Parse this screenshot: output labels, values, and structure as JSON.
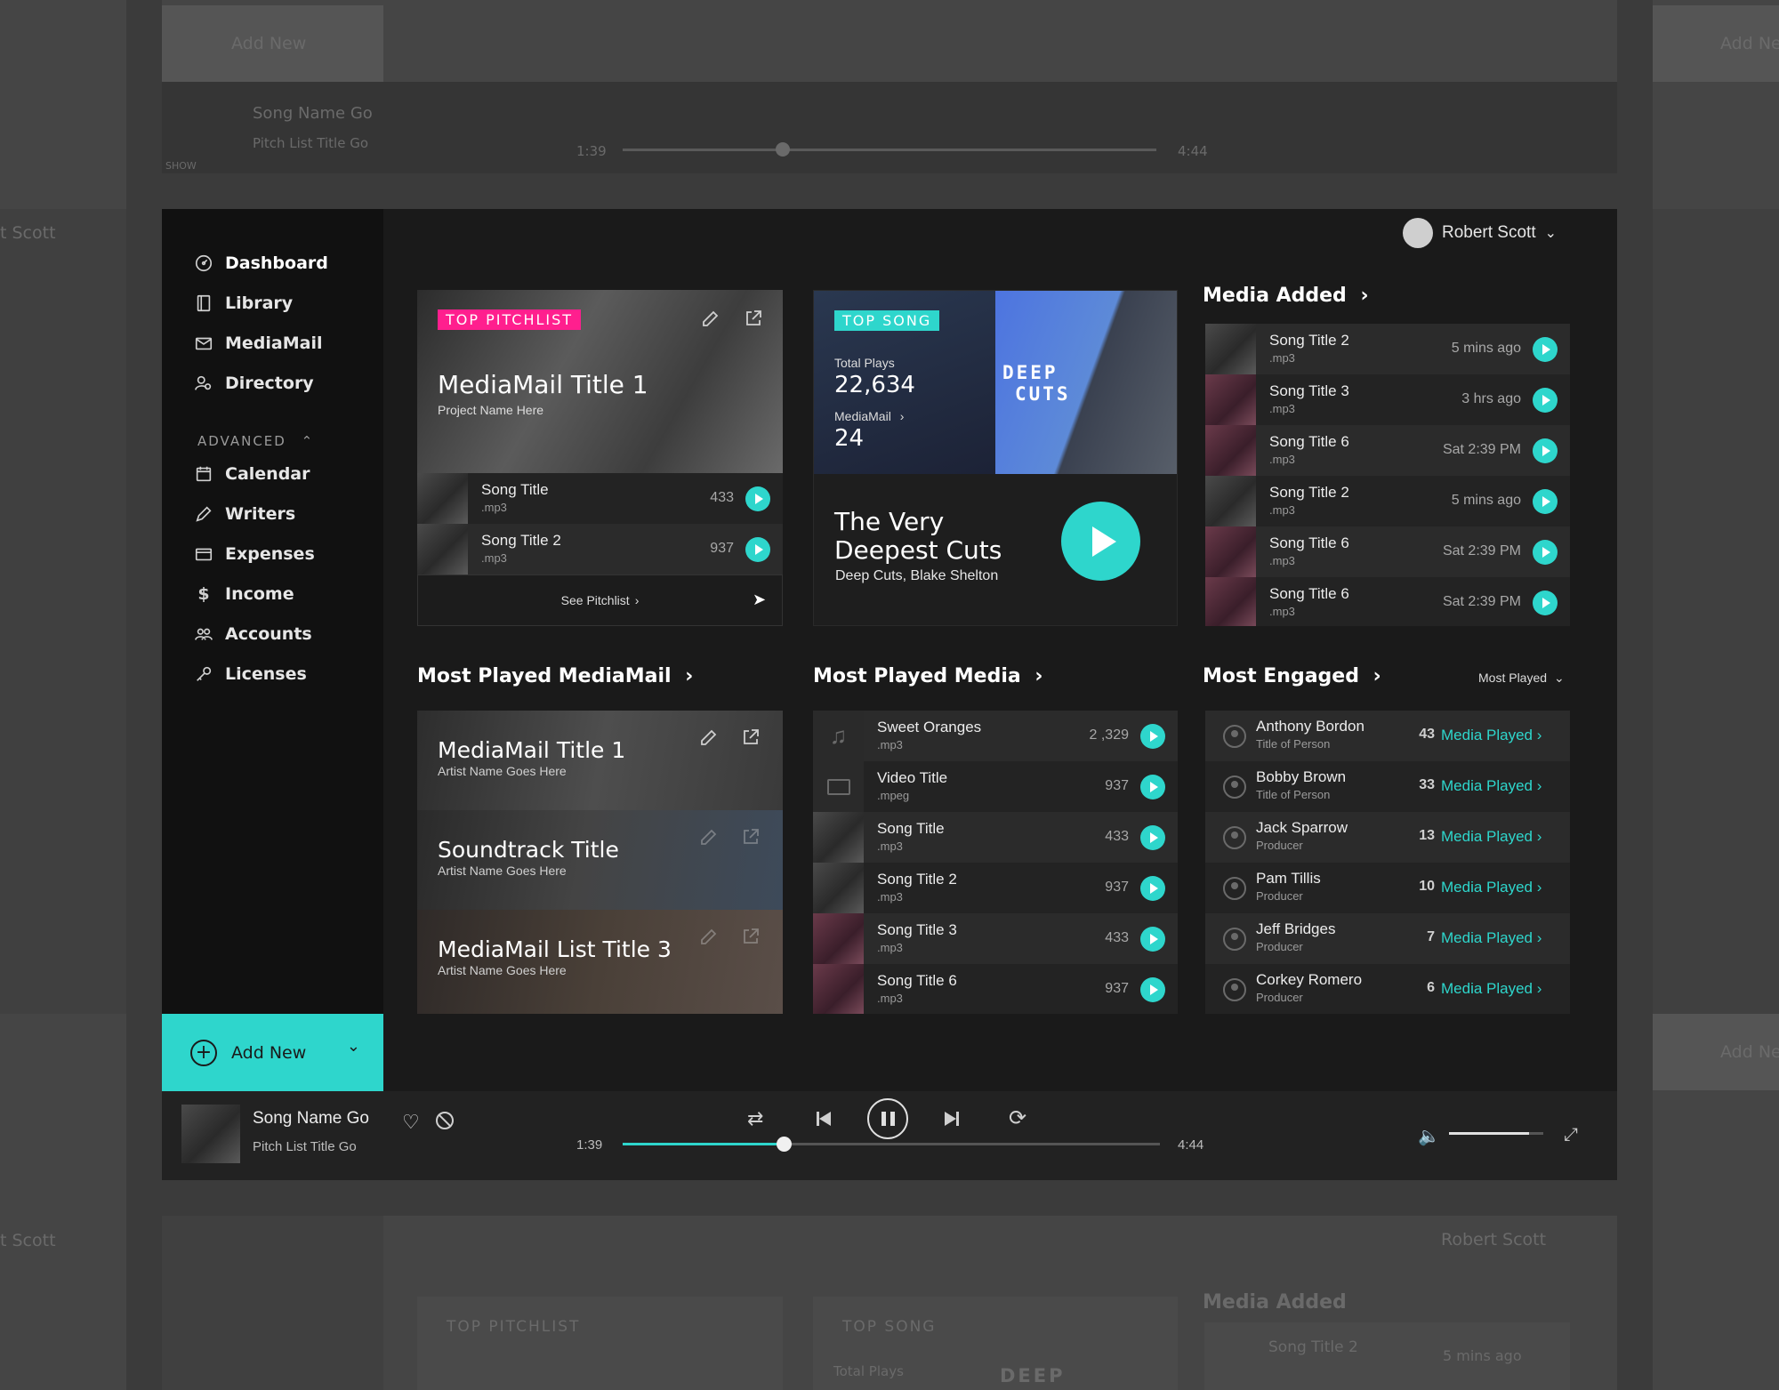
{
  "user": {
    "name": "Robert Scott"
  },
  "sidebar": {
    "items": [
      {
        "label": "Dashboard",
        "icon": "dashboard-icon",
        "active": true
      },
      {
        "label": "Library",
        "icon": "library-icon"
      },
      {
        "label": "MediaMail",
        "icon": "mail-icon"
      },
      {
        "label": "Directory",
        "icon": "directory-icon"
      }
    ],
    "advanced_label": "ADVANCED",
    "advanced_items": [
      {
        "label": "Calendar",
        "icon": "calendar-icon"
      },
      {
        "label": "Writers",
        "icon": "pen-icon"
      },
      {
        "label": "Expenses",
        "icon": "wallet-icon"
      },
      {
        "label": "Income",
        "icon": "dollar-icon"
      },
      {
        "label": "Accounts",
        "icon": "accounts-icon"
      },
      {
        "label": "Licenses",
        "icon": "key-icon"
      }
    ],
    "add_new": "Add New"
  },
  "top_pitchlist": {
    "badge": "TOP PITCHLIST",
    "title": "MediaMail Title 1",
    "subtitle": "Project Name Here",
    "songs": [
      {
        "title": "Song Title",
        "format": ".mp3",
        "count": "433"
      },
      {
        "title": "Song Title 2",
        "format": ".mp3",
        "count": "937"
      }
    ],
    "see_all": "See Pitchlist"
  },
  "top_song": {
    "badge": "TOP SONG",
    "plays_label": "Total Plays",
    "plays_value": "22,634",
    "mediamail_label": "MediaMail",
    "mediamail_value": "24",
    "cover_text_1": "DEEP",
    "cover_text_2": "CUTS",
    "title_line1": "The Very",
    "title_line2": "Deepest Cuts",
    "artist": "Deep Cuts, Blake Shelton"
  },
  "media_added": {
    "title": "Media Added",
    "items": [
      {
        "title": "Song Title 2",
        "format": ".mp3",
        "time": "5 mins ago"
      },
      {
        "title": "Song Title 3",
        "format": ".mp3",
        "time": "3 hrs ago"
      },
      {
        "title": "Song Title 6",
        "format": ".mp3",
        "time": "Sat 2:39 PM"
      },
      {
        "title": "Song Title 2",
        "format": ".mp3",
        "time": "5 mins ago"
      },
      {
        "title": "Song Title 6",
        "format": ".mp3",
        "time": "Sat 2:39 PM"
      },
      {
        "title": "Song Title 6",
        "format": ".mp3",
        "time": "Sat 2:39 PM"
      }
    ]
  },
  "most_played_mediamail": {
    "title": "Most Played MediaMail",
    "items": [
      {
        "title": "MediaMail Title 1",
        "subtitle": "Artist Name Goes Here"
      },
      {
        "title": "Soundtrack Title",
        "subtitle": "Artist Name Goes Here"
      },
      {
        "title": "MediaMail List Title 3",
        "subtitle": "Artist Name Goes Here"
      }
    ]
  },
  "most_played_media": {
    "title": "Most Played Media",
    "items": [
      {
        "title": "Sweet Oranges",
        "format": ".mp3",
        "count": "2 ,329"
      },
      {
        "title": "Video Title",
        "format": ".mpeg",
        "count": "937"
      },
      {
        "title": "Song Title",
        "format": ".mp3",
        "count": "433"
      },
      {
        "title": "Song Title 2",
        "format": ".mp3",
        "count": "937"
      },
      {
        "title": "Song Title 3",
        "format": ".mp3",
        "count": "433"
      },
      {
        "title": "Song Title 6",
        "format": ".mp3",
        "count": "937"
      }
    ]
  },
  "most_engaged": {
    "title": "Most Engaged",
    "filter": "Most Played",
    "link_label": "Media Played",
    "items": [
      {
        "name": "Anthony Bordon",
        "role": "Title of Person",
        "count": "43"
      },
      {
        "name": "Bobby Brown",
        "role": "Title of Person",
        "count": "33"
      },
      {
        "name": "Jack Sparrow",
        "role": "Producer",
        "count": "13"
      },
      {
        "name": "Pam Tillis",
        "role": "Producer",
        "count": "10"
      },
      {
        "name": "Jeff Bridges",
        "role": "Producer",
        "count": "7"
      },
      {
        "name": "Corkey Romero",
        "role": "Producer",
        "count": "6"
      }
    ]
  },
  "player": {
    "song": "Song Name Go",
    "pitchlist": "Pitch List Title Go",
    "elapsed": "1:39",
    "total": "4:44",
    "progress": 0.3,
    "volume": 0.85
  },
  "ghost": {
    "add_new": "Add New",
    "song": "Song Name Go",
    "pitchlist": "Pitch List Title Go",
    "show": "SHOW",
    "elapsed": "1:39",
    "total": "4:44",
    "user_partial": "t Scott",
    "user": "Robert Scott",
    "media_added": "Media Added",
    "badge_pitchlist": "TOP PITCHLIST",
    "badge_song": "TOP SONG",
    "plays_label": "Total Plays",
    "deep": "DEEP",
    "song_title": "Song Title 2",
    "time": "5 mins ago"
  },
  "colors": {
    "accent": "#2ed6cc",
    "badge_pink": "#ff1f8e",
    "background": "#1a1a1a"
  }
}
